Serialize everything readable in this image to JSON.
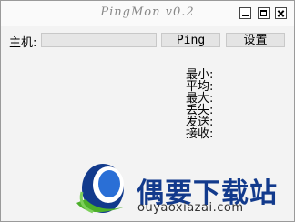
{
  "window": {
    "title": "PingMon v0.2"
  },
  "titlebar_icons": [
    "minimize-icon",
    "maximize-icon",
    "close-icon"
  ],
  "host": {
    "label": "主机:",
    "value": "",
    "placeholder": ""
  },
  "buttons": {
    "ping_label_mnemonic": "P",
    "ping_label_rest": "ing",
    "settings_label": "设置"
  },
  "stats": {
    "min_label": "最小:",
    "avg_label": "平均:",
    "max_label": "最大:",
    "lost_label": "丢失:",
    "sent_label": "发送:",
    "recv_label": "接收:"
  },
  "watermark": {
    "text": "偶要下载站",
    "url": "ouyaoxiazai.com"
  },
  "colors": {
    "window_bg": "#f3f3f3",
    "watermark_blue": "#123a8c",
    "watermark_green": "#4caf2a"
  }
}
